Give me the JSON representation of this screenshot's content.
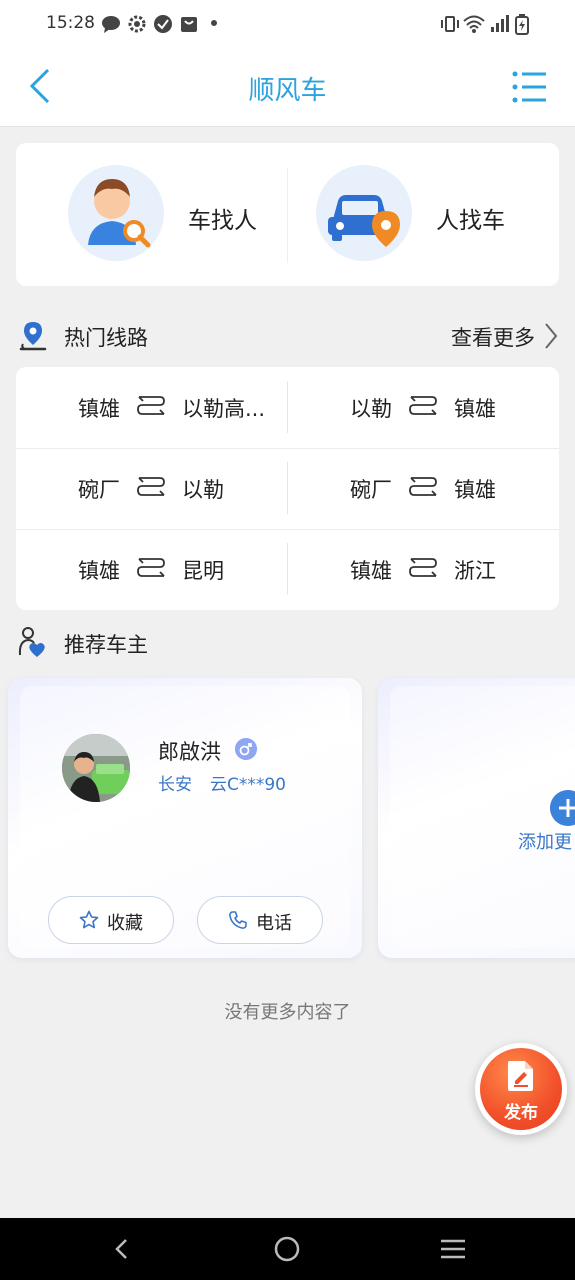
{
  "status_bar": {
    "time": "15:28"
  },
  "header": {
    "title": "顺风车"
  },
  "quick_actions": [
    {
      "label": "车找人",
      "icon": "passenger-search-icon"
    },
    {
      "label": "人找车",
      "icon": "car-location-icon"
    }
  ],
  "hot_routes": {
    "title": "热门线路",
    "more_label": "查看更多",
    "rows": [
      [
        {
          "from": "镇雄",
          "to": "以勒高..."
        },
        {
          "from": "以勒",
          "to": "镇雄"
        }
      ],
      [
        {
          "from": "碗厂",
          "to": "以勒"
        },
        {
          "from": "碗厂",
          "to": "镇雄"
        }
      ],
      [
        {
          "from": "镇雄",
          "to": "昆明"
        },
        {
          "from": "镇雄",
          "to": "浙江"
        }
      ]
    ]
  },
  "recommended_drivers": {
    "title": "推荐车主",
    "drivers": [
      {
        "name": "郎啟洪",
        "gender_icon": "male-icon",
        "car": "长安",
        "plate": "云C***90",
        "favorite_label": "收藏",
        "phone_label": "电话"
      }
    ],
    "add_label": "添加更"
  },
  "footer_text": "没有更多内容了",
  "fab": {
    "label": "发布"
  },
  "colors": {
    "accent": "#2aa3de",
    "link": "#3a78c7",
    "fab": "#f2502a"
  }
}
